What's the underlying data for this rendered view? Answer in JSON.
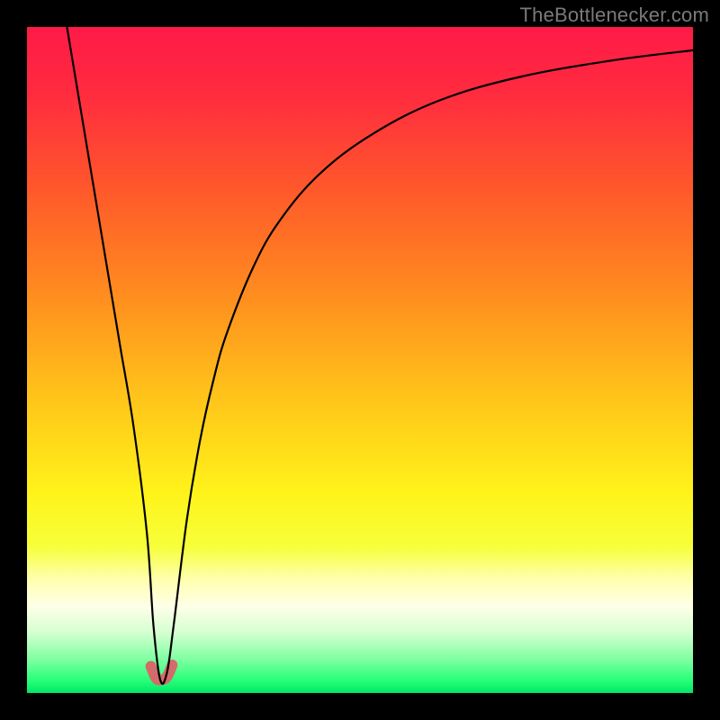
{
  "watermark": "TheBottlenecker.com",
  "gradient": {
    "stops": [
      {
        "offset": 0.0,
        "color": "#ff1a47"
      },
      {
        "offset": 0.1,
        "color": "#ff2b3f"
      },
      {
        "offset": 0.25,
        "color": "#ff5a2a"
      },
      {
        "offset": 0.4,
        "color": "#ff8c1f"
      },
      {
        "offset": 0.55,
        "color": "#ffc21a"
      },
      {
        "offset": 0.7,
        "color": "#fff31a"
      },
      {
        "offset": 0.78,
        "color": "#f6ff3a"
      },
      {
        "offset": 0.83,
        "color": "#ffffb0"
      },
      {
        "offset": 0.87,
        "color": "#ffffe8"
      },
      {
        "offset": 0.91,
        "color": "#d4ffd0"
      },
      {
        "offset": 0.95,
        "color": "#7dffa0"
      },
      {
        "offset": 0.98,
        "color": "#2aff7a"
      },
      {
        "offset": 1.0,
        "color": "#00e865"
      }
    ]
  },
  "curve": {
    "stroke": "#000000",
    "stroke_width": 2.2,
    "highlight_stroke": "#d46a6a",
    "highlight_width": 12
  },
  "chart_data": {
    "type": "line",
    "title": "",
    "xlabel": "",
    "ylabel": "",
    "xlim": [
      0,
      100
    ],
    "ylim": [
      0,
      100
    ],
    "optimum_x": 20,
    "series": [
      {
        "name": "bottleneck-curve",
        "x": [
          6,
          8,
          10,
          12,
          14,
          16,
          18,
          19,
          20,
          21,
          22,
          24,
          26,
          28,
          30,
          34,
          38,
          44,
          52,
          62,
          74,
          88,
          100
        ],
        "values": [
          100,
          88,
          76,
          64,
          52,
          40,
          24,
          10,
          2,
          3,
          10,
          26,
          38,
          47,
          54,
          64,
          71,
          78,
          84,
          89,
          92.5,
          95,
          96.5
        ]
      }
    ],
    "highlight_segment": {
      "x": [
        18.6,
        19.4,
        20.2,
        21.0,
        21.8
      ],
      "values": [
        4.0,
        2.2,
        2.0,
        2.4,
        4.2
      ]
    }
  }
}
